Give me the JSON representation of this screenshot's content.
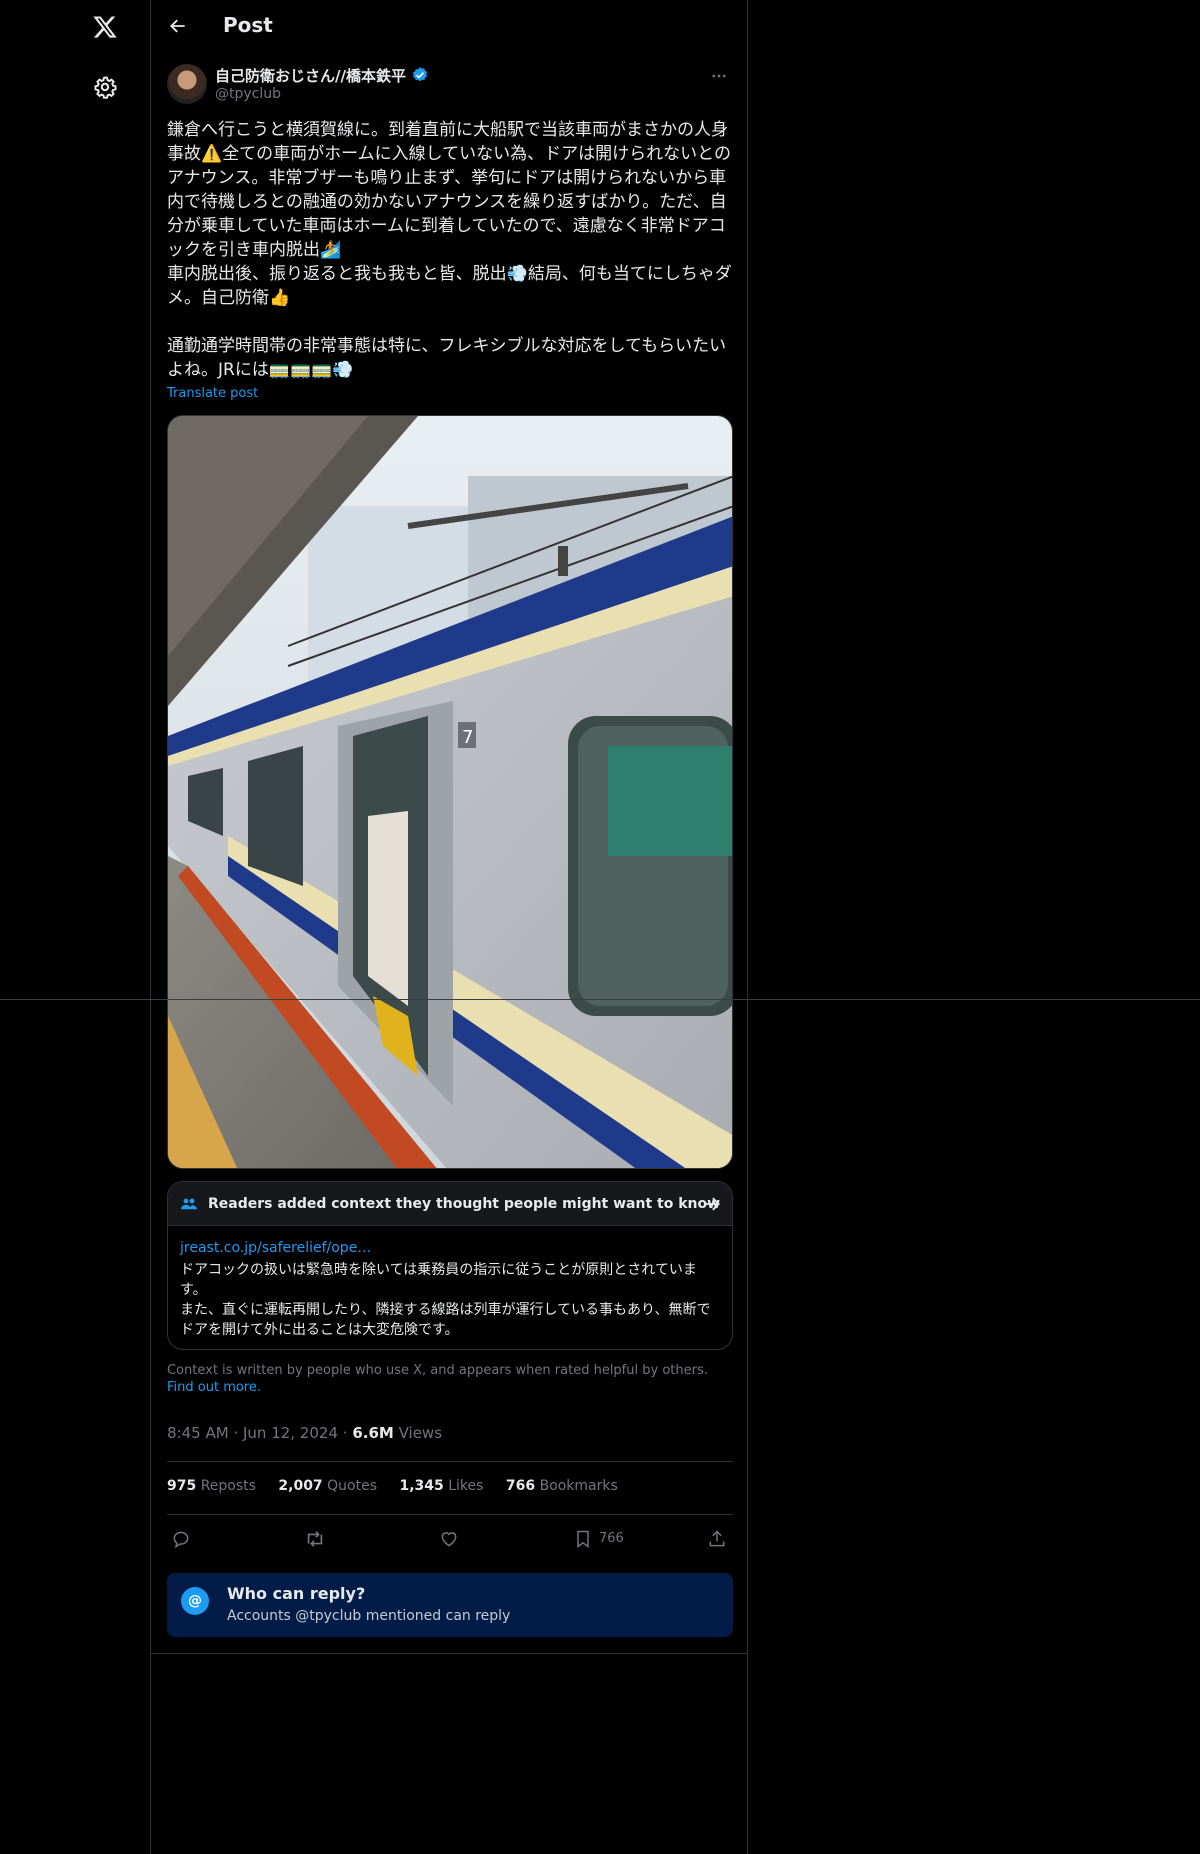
{
  "nav": {
    "logo_icon": "x-logo-icon",
    "settings_icon": "gear-icon"
  },
  "header": {
    "title": "Post",
    "back_icon": "arrow-left-icon"
  },
  "author": {
    "name": "自己防衛おじさん//橋本鉄平",
    "handle": "@tpyclub",
    "verified": true
  },
  "post": {
    "text": "鎌倉へ行こうと横須賀線に。到着直前に大船駅で当該車両がまさかの人身事故⚠️全ての車両がホームに入線していない為、ドアは開けられないとのアナウンス。非常ブザーも鳴り止まず、挙句にドアは開けられないから車内で待機しろとの融通の効かないアナウンスを繰り返すばかり。ただ、自分が乗車していた車両はホームに到着していたので、遠慮なく非常ドアコックを引き車内脱出🏄\n車内脱出後、振り返ると我も我もと皆、脱出💨結局、何も当てにしちゃダメ。自己防衛👍\n\n通勤通学時間帯の非常事態は特に、フレキシブルな対応をしてもらいたいよね。JRには🚃🚃🚃💨",
    "translate_label": "Translate post"
  },
  "community_note": {
    "title": "Readers added context they thought people might want to know",
    "link_text": "jreast.co.jp/saferelief/ope…",
    "body": "ドアコックの扱いは緊急時を除いては乗務員の指示に従うことが原則とされています。\nまた、直ぐに運転再開したり、隣接する線路は列車が運行している事もあり、無断でドアを開けて外に出ることは大変危険です。",
    "footer_text": "Context is written by people who use X, and appears when rated helpful by others.",
    "footer_link": "Find out more."
  },
  "meta": {
    "time": "8:45 AM",
    "date": "Jun 12, 2024",
    "views_count": "6.6M",
    "views_label": "Views"
  },
  "stats": {
    "reposts_count": "975",
    "reposts_label": "Reposts",
    "quotes_count": "2,007",
    "quotes_label": "Quotes",
    "likes_count": "1,345",
    "likes_label": "Likes",
    "bookmarks_count": "766",
    "bookmarks_label": "Bookmarks"
  },
  "actions": {
    "reply_icon": "reply-icon",
    "repost_icon": "repost-icon",
    "like_icon": "heart-icon",
    "bookmark_icon": "bookmark-icon",
    "bookmark_count": "766",
    "share_icon": "share-icon"
  },
  "who_can_reply": {
    "title": "Who can reply?",
    "subtitle": "Accounts @tpyclub mentioned can reply",
    "icon_text": "@"
  },
  "colors": {
    "background": "#000000",
    "text": "#e7e9ea",
    "muted": "#71767b",
    "accent": "#1d9bf0",
    "border": "#2f3336",
    "reply_banner": "#031c47"
  }
}
